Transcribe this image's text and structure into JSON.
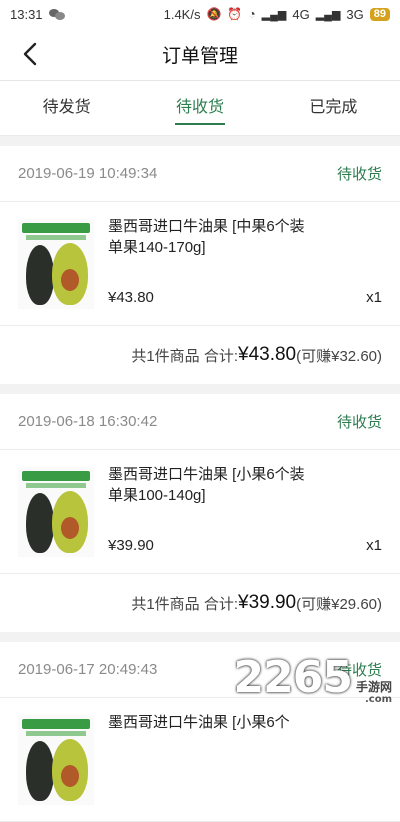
{
  "status_bar": {
    "time": "13:31",
    "net_speed": "1.4K/s",
    "sig1": "4G",
    "sig2": "3G",
    "battery": "89"
  },
  "nav": {
    "title": "订单管理"
  },
  "tabs": [
    {
      "label": "待发货"
    },
    {
      "label": "待收货"
    },
    {
      "label": "已完成"
    }
  ],
  "orders": [
    {
      "date": "2019-06-19 10:49:34",
      "status": "待收货",
      "item_name": "墨西哥进口牛油果 [中果6个装 单果140-170g]",
      "price": "¥43.80",
      "qty": "x1",
      "summary_prefix": "共1件商品 合计:",
      "total": "¥43.80",
      "earn": "(可赚¥32.60)"
    },
    {
      "date": "2019-06-18 16:30:42",
      "status": "待收货",
      "item_name": "墨西哥进口牛油果 [小果6个装 单果100-140g]",
      "price": "¥39.90",
      "qty": "x1",
      "summary_prefix": "共1件商品 合计:",
      "total": "¥39.90",
      "earn": "(可赚¥29.60)"
    },
    {
      "date": "2019-06-17 20:49:43",
      "status": "待收货",
      "item_name": "墨西哥进口牛油果 [小果6个",
      "price": "",
      "qty": "",
      "summary_prefix": "",
      "total": "",
      "earn": ""
    }
  ],
  "watermark": {
    "number": "2265",
    "site": "手游网",
    "domain": ".com"
  },
  "colors": {
    "accent": "#2e7d4f",
    "battery": "#d4a21d"
  }
}
